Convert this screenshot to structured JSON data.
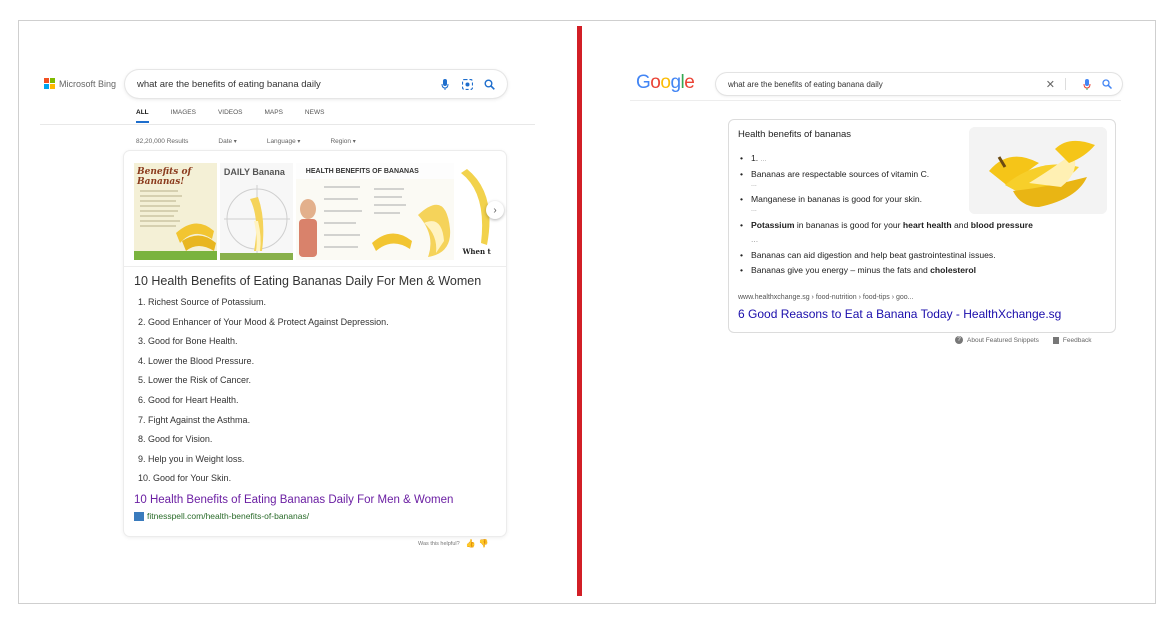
{
  "bing": {
    "brand": "Microsoft Bing",
    "search": {
      "query": "what are the benefits of eating banana daily"
    },
    "tabs": [
      "ALL",
      "IMAGES",
      "VIDEOS",
      "MAPS",
      "NEWS"
    ],
    "active_tab": "ALL",
    "results_count": "82,20,000 Results",
    "filters": [
      "Date",
      "Language",
      "Region"
    ],
    "images": [
      {
        "label": "Benefits of Bananas!"
      },
      {
        "label": "DAILY Banana"
      },
      {
        "label": "HEALTH BENEFITS OF BANANAS"
      },
      {
        "label": "When t"
      }
    ],
    "answer_title": "10 Health Benefits of Eating Bananas Daily For Men & Women",
    "list": [
      "1. Richest Source of Potassium.",
      "2. Good Enhancer of Your Mood & Protect Against Depression.",
      "3. Good for Bone Health.",
      "4. Lower the Blood Pressure.",
      "5. Lower the Risk of Cancer.",
      "6. Good for Heart Health.",
      "7. Fight Against the Asthma.",
      "8. Good for Vision.",
      "9. Help you in Weight loss.",
      "10. Good for Your Skin."
    ],
    "source_link": "10 Health Benefits of Eating Bananas Daily For Men & Women",
    "source_url": "fitnesspell.com/health-benefits-of-bananas/",
    "helpful": "Was this helpful?",
    "colors": {
      "accent": "#1e6ecd",
      "visited": "#6b1fa3",
      "url": "#2a6b2a"
    }
  },
  "google": {
    "logo": "Google",
    "search": {
      "query": "what are the benefits of eating banana daily"
    },
    "snippet_title": "Health benefits of bananas",
    "bullets": {
      "b1": "1.",
      "b2": "Bananas are respectable sources of vitamin C.",
      "b3": "Manganese in bananas is good for your skin.",
      "b4": {
        "p1": "Potassium",
        "p2": " in bananas is good for your ",
        "p3": "heart health",
        "p4": " and ",
        "p5": "blood pressure",
        "p6": " ..."
      },
      "b5": "Bananas can aid digestion and help beat gastrointestinal issues.",
      "b6": {
        "p1": "Bananas give you energy – minus the fats and ",
        "p2": "cholesterol"
      }
    },
    "ellipsis": "...",
    "breadcrumb": "www.healthxchange.sg › food-nutrition › food-tips › goo...",
    "result_link": "6 Good Reasons to Eat a Banana Today - HealthXchange.sg",
    "footer": {
      "about": "About Featured Snippets",
      "feedback": "Feedback"
    },
    "colors": {
      "link": "#1a0dab"
    }
  },
  "divider_color": "#d21f26"
}
